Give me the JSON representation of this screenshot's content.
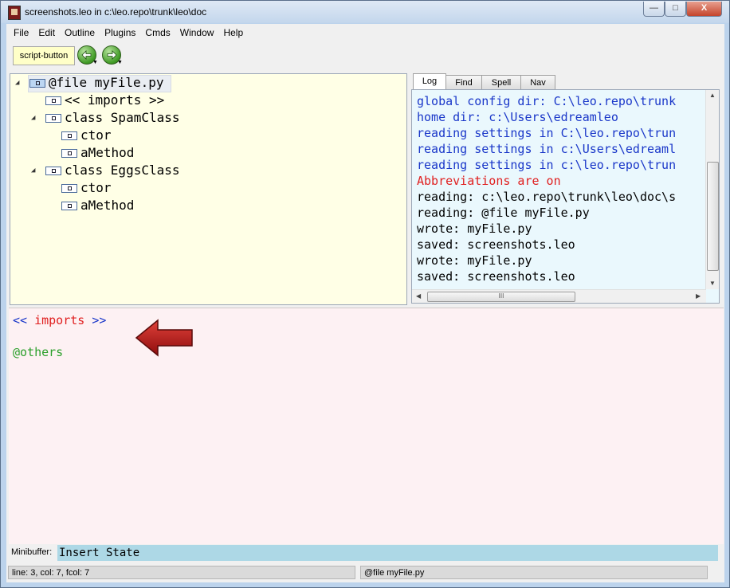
{
  "window": {
    "title": "screenshots.leo in c:\\leo.repo\\trunk\\leo\\doc",
    "minimize_glyph": "—",
    "maximize_glyph": "□",
    "close_glyph": "X"
  },
  "menu": [
    "File",
    "Edit",
    "Outline",
    "Plugins",
    "Cmds",
    "Window",
    "Help"
  ],
  "toolbar": {
    "script_button_label": "script-button",
    "back_icon": "green-left-arrow-icon",
    "forward_icon": "green-right-arrow-icon"
  },
  "outline": {
    "nodes": [
      {
        "label": "@file myFile.py",
        "expanded": true,
        "selected": true
      },
      {
        "label": "<< imports >>"
      },
      {
        "label": "class SpamClass",
        "expanded": true
      },
      {
        "label": "ctor"
      },
      {
        "label": "aMethod"
      },
      {
        "label": "class EggsClass",
        "expanded": true
      },
      {
        "label": "ctor"
      },
      {
        "label": "aMethod"
      }
    ],
    "background": "#ffffe6"
  },
  "log": {
    "tabs": [
      "Log",
      "Find",
      "Spell",
      "Nav"
    ],
    "active_tab": "Log",
    "lines": [
      {
        "text": "global config dir: C:\\leo.repo\\trunk",
        "color": "#1a37c9"
      },
      {
        "text": "home dir: c:\\Users\\edreamleo",
        "color": "#1a37c9"
      },
      {
        "text": "reading settings in C:\\leo.repo\\trun",
        "color": "#1a37c9"
      },
      {
        "text": "reading settings in c:\\Users\\edreaml",
        "color": "#1a37c9"
      },
      {
        "text": "reading settings in c:\\leo.repo\\trun",
        "color": "#1a37c9"
      },
      {
        "text": "Abbreviations are on",
        "color": "#e02020"
      },
      {
        "text": "reading: c:\\leo.repo\\trunk\\leo\\doc\\s",
        "color": "#000000"
      },
      {
        "text": "reading: @file myFile.py",
        "color": "#000000"
      },
      {
        "text": "wrote: myFile.py",
        "color": "#000000"
      },
      {
        "text": "saved: screenshots.leo",
        "color": "#000000"
      },
      {
        "text": "wrote: myFile.py",
        "color": "#000000"
      },
      {
        "text": "saved: screenshots.leo",
        "color": "#000000"
      }
    ],
    "hscroll_grip": "III",
    "background": "#eaf8fd"
  },
  "body": {
    "line1_open": "<<",
    "line1_name": " imports ",
    "line1_close": ">>",
    "line3": "@others",
    "colors": {
      "delim": "#1a37c9",
      "name": "#e02020",
      "directive": "#2ca02c"
    },
    "background": "#fdf1f3"
  },
  "minibuffer": {
    "label": "Minibuffer:",
    "value": "Insert State"
  },
  "status": {
    "position": "line: 3, col: 7, fcol: 7",
    "node": "@file myFile.py"
  }
}
